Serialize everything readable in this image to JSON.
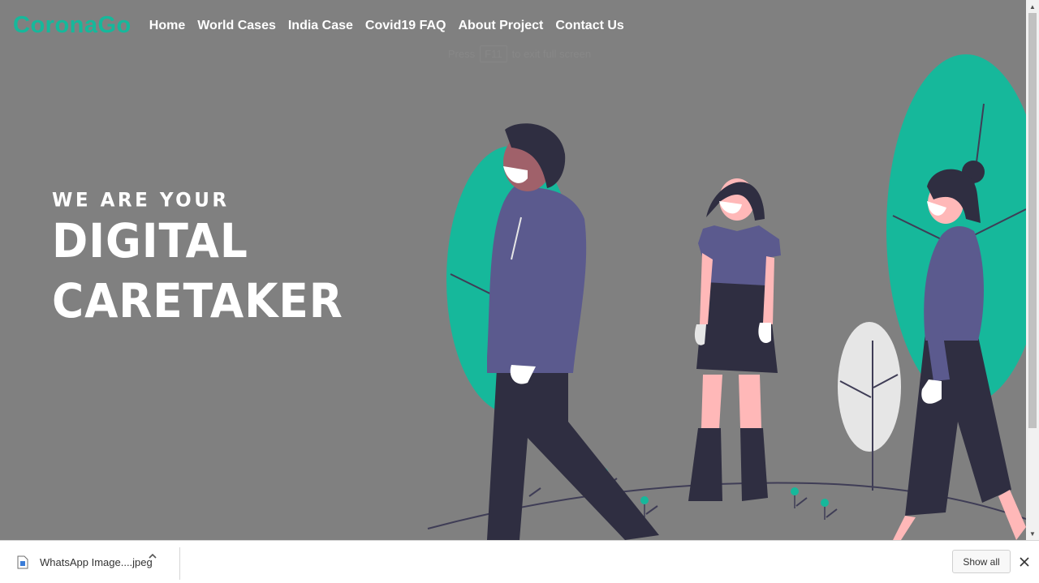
{
  "navbar": {
    "brand": "CoronaGo",
    "links": [
      "Home",
      "World Cases",
      "India Case",
      "Covid19 FAQ",
      "About Project",
      "Contact Us"
    ]
  },
  "fullscreen_toast": {
    "prefix": "Press",
    "key": "F11",
    "suffix": "to exit full screen"
  },
  "hero": {
    "line1": "WE ARE YOUR",
    "line2": "DIGITAL",
    "line3": "CARETAKER"
  },
  "illustration": {
    "name": "masked-people-walking-illustration",
    "colors": {
      "teal": "#16b89b",
      "purple": "#5b5a8e",
      "dark": "#2f2e41",
      "skin_dark": "#a0616a",
      "skin_light": "#ffb8b8",
      "white": "#ffffff",
      "light_gray": "#e6e6e6"
    }
  },
  "download_bar": {
    "file_name": "WhatsApp Image....jpeg",
    "show_all_label": "Show all"
  },
  "colors": {
    "page_background": "#808080",
    "brand": "#16b89b",
    "text": "#ffffff"
  }
}
